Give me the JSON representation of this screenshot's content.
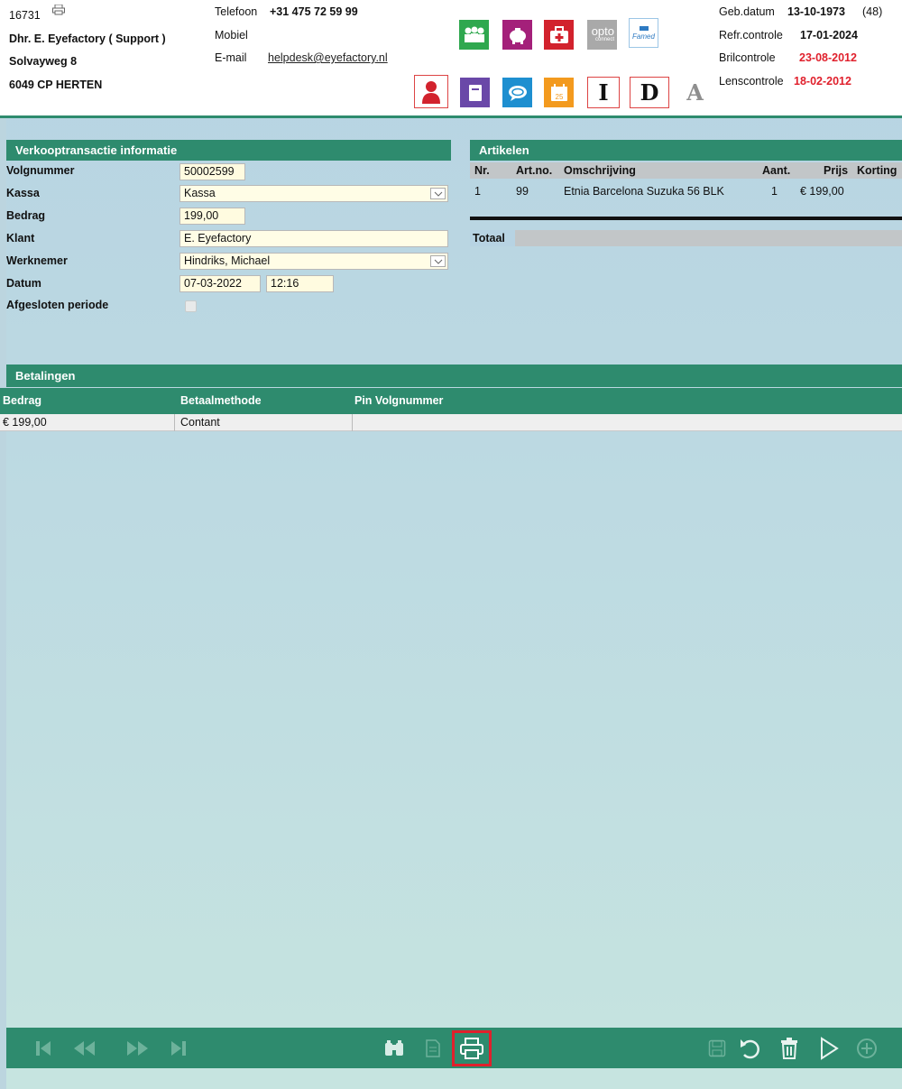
{
  "header": {
    "customer_id": "16731",
    "name": "Dhr. E. Eyefactory ( Support )",
    "street": "Solvayweg 8",
    "city": "6049 CP HERTEN",
    "phone_label": "Telefoon",
    "phone_value": "+31 475 72 59 99",
    "mobile_label": "Mobiel",
    "email_label": "E-mail",
    "email_value": "helpdesk@eyefactory.nl",
    "birth_label": "Geb.datum",
    "birth_value": "13-10-1973",
    "birth_age": "(48)",
    "refr_label": "Refr.controle",
    "refr_value": "17-01-2024",
    "bril_label": "Brilcontrole",
    "bril_value": "23-08-2012",
    "lens_label": "Lenscontrole",
    "lens_value": "18-02-2012",
    "opto_text": "opto",
    "opto_sub": "connect",
    "famed_text": "Famed",
    "letter_i": "I",
    "letter_d": "D",
    "letter_a": "A",
    "calendar_num": "25"
  },
  "colors": {
    "brand_green": "#2e8b6e",
    "alert_red": "#e0202c",
    "tile_green": "#2fa84f",
    "tile_magenta": "#a4207a",
    "tile_red": "#d2222d",
    "tile_grey": "#a9a9a9",
    "tile_purple": "#6a48a8",
    "tile_blue": "#1e8fd0",
    "tile_orange": "#f39a1e"
  },
  "transaction": {
    "title": "Verkooptransactie informatie",
    "volgnummer_label": "Volgnummer",
    "volgnummer_value": "50002599",
    "kassa_label": "Kassa",
    "kassa_value": "Kassa",
    "bedrag_label": "Bedrag",
    "bedrag_value": "199,00",
    "klant_label": "Klant",
    "klant_value": "E. Eyefactory",
    "werknemer_label": "Werknemer",
    "werknemer_value": "Hindriks, Michael",
    "datum_label": "Datum",
    "datum_value": "07-03-2022",
    "tijd_value": "12:16",
    "afgesloten_label": "Afgesloten periode"
  },
  "articles": {
    "title": "Artikelen",
    "columns": [
      "Nr.",
      "Art.no.",
      "Omschrijving",
      "Aant.",
      "Prijs",
      "Korting"
    ],
    "rows": [
      {
        "nr": "1",
        "artno": "99",
        "omschrijving": "Etnia Barcelona Suzuka 56 BLK",
        "aant": "1",
        "prijs": "€ 199,00",
        "korting": ""
      }
    ],
    "total_label": "Totaal"
  },
  "payments": {
    "title": "Betalingen",
    "columns": [
      "Bedrag",
      "Betaalmethode",
      "Pin Volgnummer"
    ],
    "rows": [
      {
        "bedrag": "€ 199,00",
        "methode": "Contant",
        "pin": ""
      }
    ]
  },
  "toolbar": {
    "icons": [
      "first-icon",
      "previous-icon",
      "next-icon",
      "last-icon",
      "binoculars-icon",
      "document-icon",
      "printer-icon",
      "save-icon",
      "undo-icon",
      "trash-icon",
      "play-icon",
      "add-icon"
    ]
  }
}
